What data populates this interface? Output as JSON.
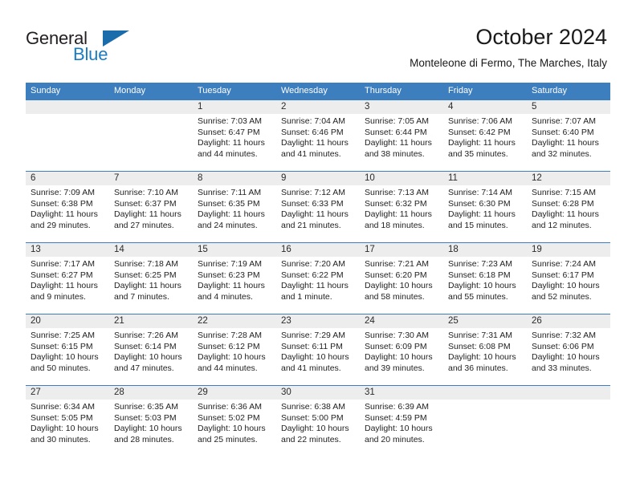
{
  "brand": {
    "name_part1": "General",
    "name_part2": "Blue",
    "triangle_color": "#1b6cab",
    "blue_color": "#1b7cc2"
  },
  "header": {
    "title": "October 2024",
    "subtitle": "Monteleone di Fermo, The Marches, Italy"
  },
  "theme": {
    "header_blue": "#3d7ebe",
    "date_band_gray": "#ededed",
    "text_color": "#1f1f1f"
  },
  "weekdays": [
    "Sunday",
    "Monday",
    "Tuesday",
    "Wednesday",
    "Thursday",
    "Friday",
    "Saturday"
  ],
  "weeks": [
    {
      "days": [
        {
          "date": "",
          "sunrise": "",
          "sunset": "",
          "daylight1": "",
          "daylight2": "",
          "empty": true
        },
        {
          "date": "",
          "sunrise": "",
          "sunset": "",
          "daylight1": "",
          "daylight2": "",
          "empty": true
        },
        {
          "date": "1",
          "sunrise": "Sunrise: 7:03 AM",
          "sunset": "Sunset: 6:47 PM",
          "daylight1": "Daylight: 11 hours",
          "daylight2": "and 44 minutes.",
          "empty": false
        },
        {
          "date": "2",
          "sunrise": "Sunrise: 7:04 AM",
          "sunset": "Sunset: 6:46 PM",
          "daylight1": "Daylight: 11 hours",
          "daylight2": "and 41 minutes.",
          "empty": false
        },
        {
          "date": "3",
          "sunrise": "Sunrise: 7:05 AM",
          "sunset": "Sunset: 6:44 PM",
          "daylight1": "Daylight: 11 hours",
          "daylight2": "and 38 minutes.",
          "empty": false
        },
        {
          "date": "4",
          "sunrise": "Sunrise: 7:06 AM",
          "sunset": "Sunset: 6:42 PM",
          "daylight1": "Daylight: 11 hours",
          "daylight2": "and 35 minutes.",
          "empty": false
        },
        {
          "date": "5",
          "sunrise": "Sunrise: 7:07 AM",
          "sunset": "Sunset: 6:40 PM",
          "daylight1": "Daylight: 11 hours",
          "daylight2": "and 32 minutes.",
          "empty": false
        }
      ]
    },
    {
      "days": [
        {
          "date": "6",
          "sunrise": "Sunrise: 7:09 AM",
          "sunset": "Sunset: 6:38 PM",
          "daylight1": "Daylight: 11 hours",
          "daylight2": "and 29 minutes.",
          "empty": false
        },
        {
          "date": "7",
          "sunrise": "Sunrise: 7:10 AM",
          "sunset": "Sunset: 6:37 PM",
          "daylight1": "Daylight: 11 hours",
          "daylight2": "and 27 minutes.",
          "empty": false
        },
        {
          "date": "8",
          "sunrise": "Sunrise: 7:11 AM",
          "sunset": "Sunset: 6:35 PM",
          "daylight1": "Daylight: 11 hours",
          "daylight2": "and 24 minutes.",
          "empty": false
        },
        {
          "date": "9",
          "sunrise": "Sunrise: 7:12 AM",
          "sunset": "Sunset: 6:33 PM",
          "daylight1": "Daylight: 11 hours",
          "daylight2": "and 21 minutes.",
          "empty": false
        },
        {
          "date": "10",
          "sunrise": "Sunrise: 7:13 AM",
          "sunset": "Sunset: 6:32 PM",
          "daylight1": "Daylight: 11 hours",
          "daylight2": "and 18 minutes.",
          "empty": false
        },
        {
          "date": "11",
          "sunrise": "Sunrise: 7:14 AM",
          "sunset": "Sunset: 6:30 PM",
          "daylight1": "Daylight: 11 hours",
          "daylight2": "and 15 minutes.",
          "empty": false
        },
        {
          "date": "12",
          "sunrise": "Sunrise: 7:15 AM",
          "sunset": "Sunset: 6:28 PM",
          "daylight1": "Daylight: 11 hours",
          "daylight2": "and 12 minutes.",
          "empty": false
        }
      ]
    },
    {
      "days": [
        {
          "date": "13",
          "sunrise": "Sunrise: 7:17 AM",
          "sunset": "Sunset: 6:27 PM",
          "daylight1": "Daylight: 11 hours",
          "daylight2": "and 9 minutes.",
          "empty": false
        },
        {
          "date": "14",
          "sunrise": "Sunrise: 7:18 AM",
          "sunset": "Sunset: 6:25 PM",
          "daylight1": "Daylight: 11 hours",
          "daylight2": "and 7 minutes.",
          "empty": false
        },
        {
          "date": "15",
          "sunrise": "Sunrise: 7:19 AM",
          "sunset": "Sunset: 6:23 PM",
          "daylight1": "Daylight: 11 hours",
          "daylight2": "and 4 minutes.",
          "empty": false
        },
        {
          "date": "16",
          "sunrise": "Sunrise: 7:20 AM",
          "sunset": "Sunset: 6:22 PM",
          "daylight1": "Daylight: 11 hours",
          "daylight2": "and 1 minute.",
          "empty": false
        },
        {
          "date": "17",
          "sunrise": "Sunrise: 7:21 AM",
          "sunset": "Sunset: 6:20 PM",
          "daylight1": "Daylight: 10 hours",
          "daylight2": "and 58 minutes.",
          "empty": false
        },
        {
          "date": "18",
          "sunrise": "Sunrise: 7:23 AM",
          "sunset": "Sunset: 6:18 PM",
          "daylight1": "Daylight: 10 hours",
          "daylight2": "and 55 minutes.",
          "empty": false
        },
        {
          "date": "19",
          "sunrise": "Sunrise: 7:24 AM",
          "sunset": "Sunset: 6:17 PM",
          "daylight1": "Daylight: 10 hours",
          "daylight2": "and 52 minutes.",
          "empty": false
        }
      ]
    },
    {
      "days": [
        {
          "date": "20",
          "sunrise": "Sunrise: 7:25 AM",
          "sunset": "Sunset: 6:15 PM",
          "daylight1": "Daylight: 10 hours",
          "daylight2": "and 50 minutes.",
          "empty": false
        },
        {
          "date": "21",
          "sunrise": "Sunrise: 7:26 AM",
          "sunset": "Sunset: 6:14 PM",
          "daylight1": "Daylight: 10 hours",
          "daylight2": "and 47 minutes.",
          "empty": false
        },
        {
          "date": "22",
          "sunrise": "Sunrise: 7:28 AM",
          "sunset": "Sunset: 6:12 PM",
          "daylight1": "Daylight: 10 hours",
          "daylight2": "and 44 minutes.",
          "empty": false
        },
        {
          "date": "23",
          "sunrise": "Sunrise: 7:29 AM",
          "sunset": "Sunset: 6:11 PM",
          "daylight1": "Daylight: 10 hours",
          "daylight2": "and 41 minutes.",
          "empty": false
        },
        {
          "date": "24",
          "sunrise": "Sunrise: 7:30 AM",
          "sunset": "Sunset: 6:09 PM",
          "daylight1": "Daylight: 10 hours",
          "daylight2": "and 39 minutes.",
          "empty": false
        },
        {
          "date": "25",
          "sunrise": "Sunrise: 7:31 AM",
          "sunset": "Sunset: 6:08 PM",
          "daylight1": "Daylight: 10 hours",
          "daylight2": "and 36 minutes.",
          "empty": false
        },
        {
          "date": "26",
          "sunrise": "Sunrise: 7:32 AM",
          "sunset": "Sunset: 6:06 PM",
          "daylight1": "Daylight: 10 hours",
          "daylight2": "and 33 minutes.",
          "empty": false
        }
      ]
    },
    {
      "days": [
        {
          "date": "27",
          "sunrise": "Sunrise: 6:34 AM",
          "sunset": "Sunset: 5:05 PM",
          "daylight1": "Daylight: 10 hours",
          "daylight2": "and 30 minutes.",
          "empty": false
        },
        {
          "date": "28",
          "sunrise": "Sunrise: 6:35 AM",
          "sunset": "Sunset: 5:03 PM",
          "daylight1": "Daylight: 10 hours",
          "daylight2": "and 28 minutes.",
          "empty": false
        },
        {
          "date": "29",
          "sunrise": "Sunrise: 6:36 AM",
          "sunset": "Sunset: 5:02 PM",
          "daylight1": "Daylight: 10 hours",
          "daylight2": "and 25 minutes.",
          "empty": false
        },
        {
          "date": "30",
          "sunrise": "Sunrise: 6:38 AM",
          "sunset": "Sunset: 5:00 PM",
          "daylight1": "Daylight: 10 hours",
          "daylight2": "and 22 minutes.",
          "empty": false
        },
        {
          "date": "31",
          "sunrise": "Sunrise: 6:39 AM",
          "sunset": "Sunset: 4:59 PM",
          "daylight1": "Daylight: 10 hours",
          "daylight2": "and 20 minutes.",
          "empty": false
        },
        {
          "date": "",
          "sunrise": "",
          "sunset": "",
          "daylight1": "",
          "daylight2": "",
          "empty": true
        },
        {
          "date": "",
          "sunrise": "",
          "sunset": "",
          "daylight1": "",
          "daylight2": "",
          "empty": true
        }
      ]
    }
  ]
}
